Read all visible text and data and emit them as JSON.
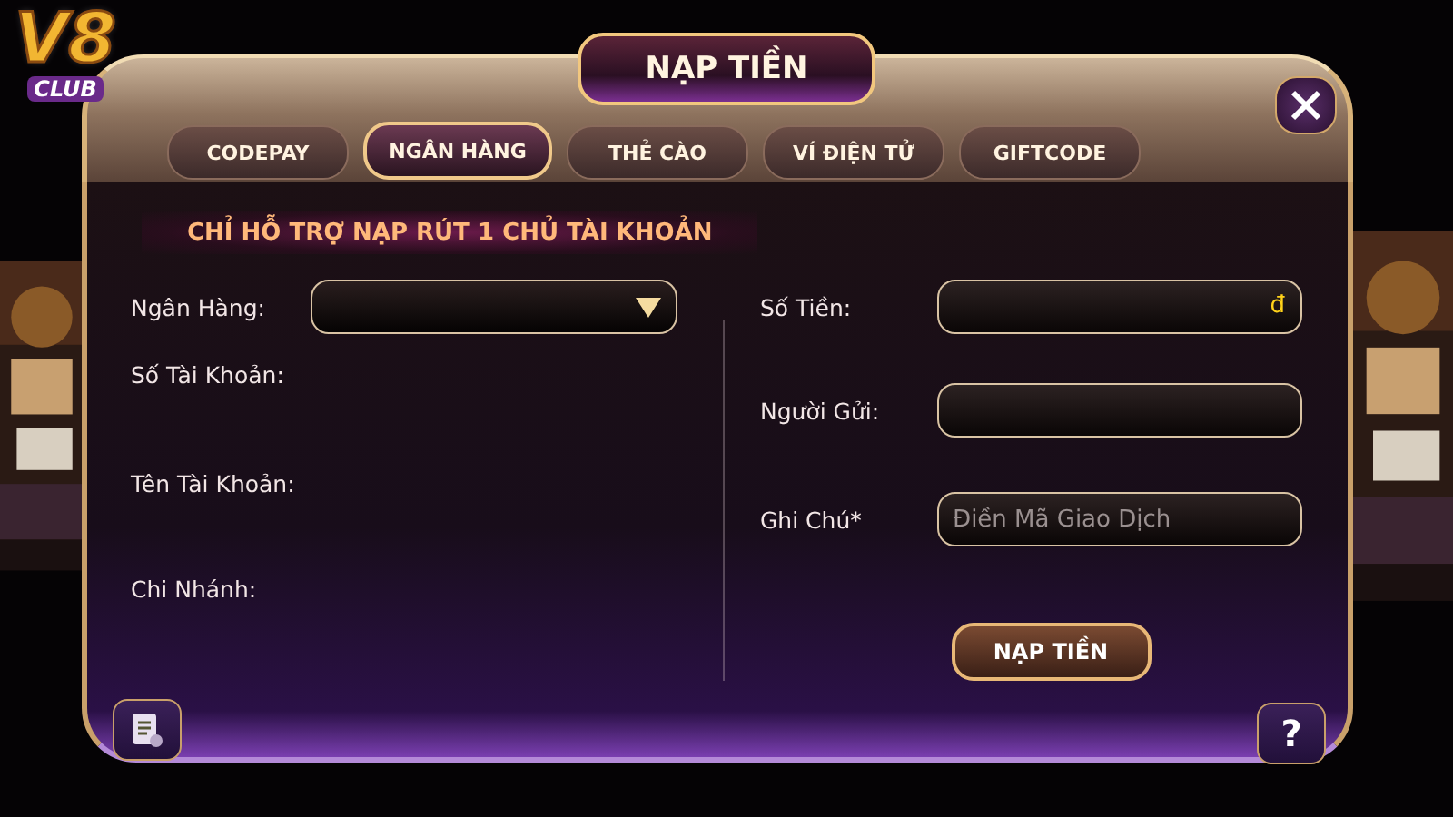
{
  "logo": {
    "mark": "V8",
    "sub": "CLUB"
  },
  "title": "NẠP TIỀN",
  "tabs": [
    {
      "label": "CODEPAY",
      "selected": false
    },
    {
      "label": "NGÂN HÀNG",
      "selected": true
    },
    {
      "label": "THẺ CÀO",
      "selected": false
    },
    {
      "label": "VÍ ĐIỆN TỬ",
      "selected": false
    },
    {
      "label": "GIFTCODE",
      "selected": false
    }
  ],
  "notice": "CHỈ HỖ TRỢ NẠP RÚT 1 CHỦ TÀI KHOẢN",
  "bank_info": [
    {
      "label": "Ngân Hàng:",
      "kind": "dropdown"
    },
    {
      "label": "Số Tài Khoản:",
      "kind": "text"
    },
    {
      "label": "Tên Tài Khoản:",
      "kind": "text"
    },
    {
      "label": "Chi Nhánh:",
      "kind": "text"
    }
  ],
  "deposit_form": [
    {
      "label": "Số Tiền:",
      "suffix": "đ"
    },
    {
      "label": "Người Gửi:"
    },
    {
      "label": "Ghi Chú*",
      "placeholder": "Điền Mã Giao Dịch"
    }
  ],
  "submit_button": "NẠP TIỀN",
  "help_button": "?"
}
